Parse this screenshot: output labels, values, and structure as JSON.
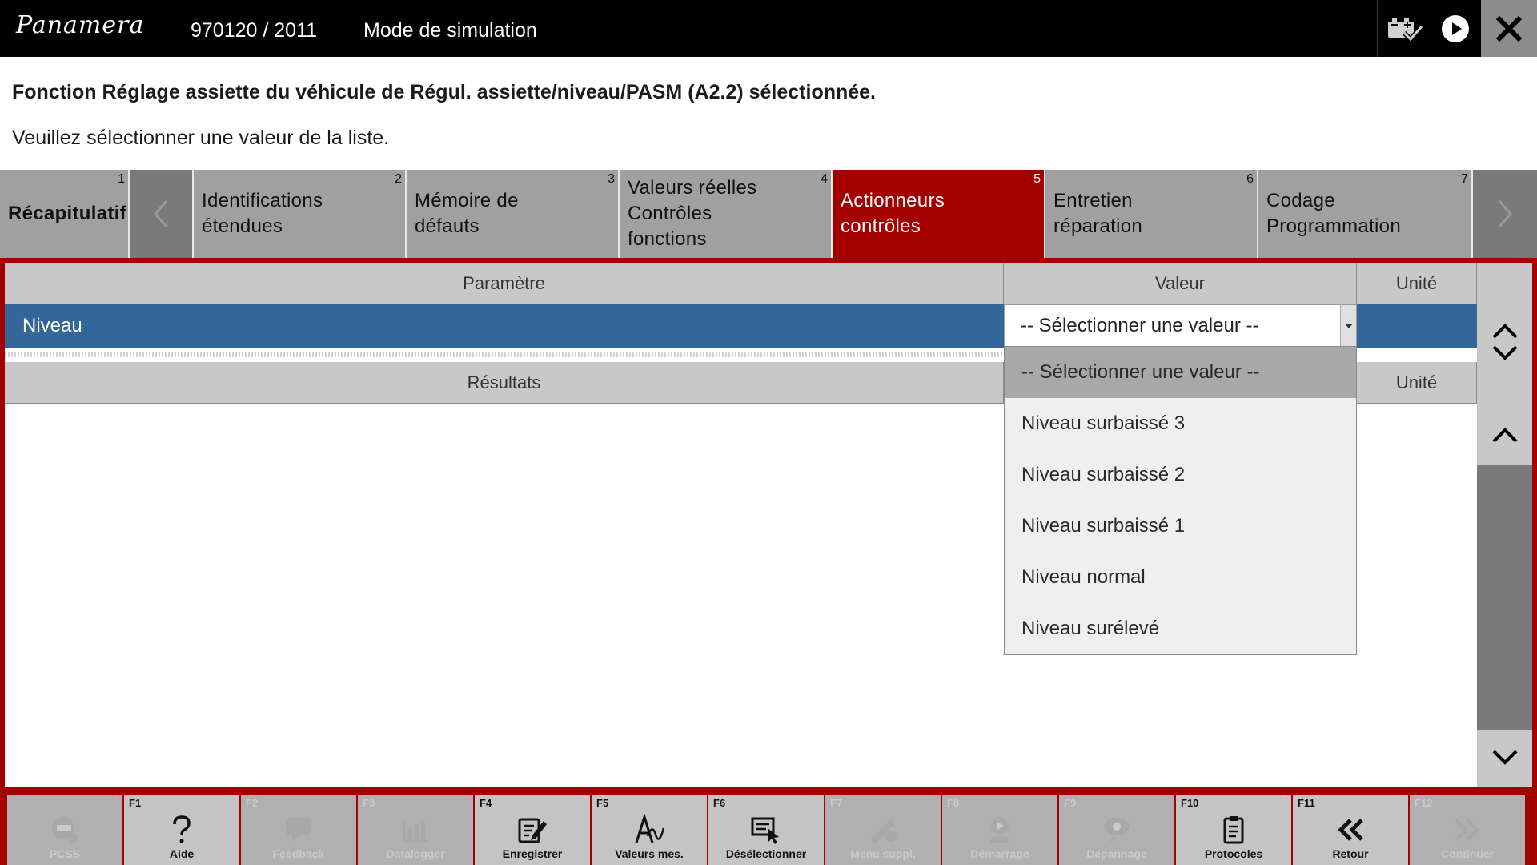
{
  "header": {
    "brand": "Panamera",
    "vehicle": "970120 / 2011",
    "mode": "Mode de simulation",
    "icons": [
      "battery-check-icon",
      "play-icon",
      "close-icon"
    ]
  },
  "messages": {
    "title": "Fonction Réglage assiette du véhicule de Régul. assiette/niveau/PASM (A2.2) sélectionnée.",
    "instruction": "Veuillez sélectionner une valeur de la liste."
  },
  "tabs": [
    {
      "num": "1",
      "label": "Récapitulatif"
    },
    {
      "num": "2",
      "label": "Identifications étendues"
    },
    {
      "num": "3",
      "label": "Mémoire de défauts"
    },
    {
      "num": "4",
      "label": "Valeurs réelles Contrôles fonctions"
    },
    {
      "num": "5",
      "label": "Actionneurs contrôles",
      "active": true
    },
    {
      "num": "6",
      "label": "Entretien réparation"
    },
    {
      "num": "7",
      "label": "Codage Programmation"
    }
  ],
  "table": {
    "headers": {
      "param": "Paramètre",
      "value": "Valeur",
      "unit": "Unité"
    },
    "row": {
      "param": "Niveau",
      "value": "-- Sélectionner une valeur --",
      "unit": ""
    }
  },
  "results": {
    "headers": {
      "label": "Résultats",
      "unit": "Unité"
    }
  },
  "dropdown": {
    "selected_index": 0,
    "options": [
      "-- Sélectionner une valeur --",
      "Niveau surbaissé 3",
      "Niveau surbaissé 2",
      "Niveau surbaissé 1",
      "Niveau normal",
      "Niveau surélevé"
    ]
  },
  "colors": {
    "accent": "#a40000",
    "selected_row": "#336699",
    "header_bg": "#000000",
    "tab_bg": "#a0a0a0"
  },
  "footer": [
    {
      "key": "",
      "label": "PCSS",
      "icon": "pcss-icon",
      "enabled": false
    },
    {
      "key": "F1",
      "label": "Aide",
      "icon": "help-icon",
      "enabled": true
    },
    {
      "key": "F2",
      "label": "Feedback",
      "icon": "feedback-icon",
      "enabled": false
    },
    {
      "key": "F3",
      "label": "Datalogger",
      "icon": "datalogger-icon",
      "enabled": false
    },
    {
      "key": "F4",
      "label": "Enregistrer",
      "icon": "save-icon",
      "enabled": true
    },
    {
      "key": "F5",
      "label": "Valeurs mes.",
      "icon": "measured-values-icon",
      "enabled": true
    },
    {
      "key": "F6",
      "label": "Désélectionner",
      "icon": "deselect-icon",
      "enabled": true
    },
    {
      "key": "F7",
      "label": "Menu suppl.",
      "icon": "additional-menu-icon",
      "enabled": false
    },
    {
      "key": "F8",
      "label": "Démarrage",
      "icon": "start-icon",
      "enabled": false
    },
    {
      "key": "F9",
      "label": "Dépannage",
      "icon": "troubleshooting-icon",
      "enabled": false
    },
    {
      "key": "F10",
      "label": "Protocoles",
      "icon": "protocols-icon",
      "enabled": true
    },
    {
      "key": "F11",
      "label": "Retour",
      "icon": "back-icon",
      "enabled": true
    },
    {
      "key": "F12",
      "label": "Continuer",
      "icon": "continue-icon",
      "enabled": false
    }
  ]
}
